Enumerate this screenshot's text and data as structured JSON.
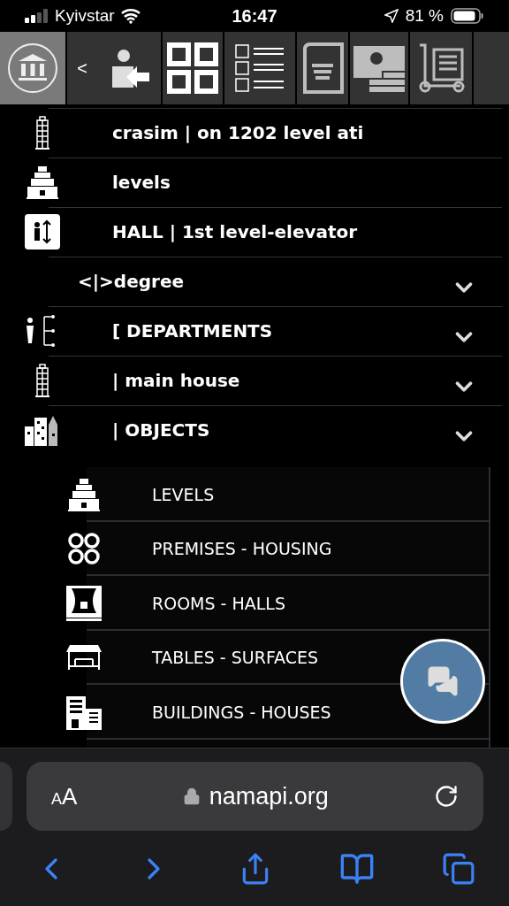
{
  "status_bar": {
    "carrier": "Kyivstar",
    "time": "16:47",
    "battery": "81 %"
  },
  "toolbar": {
    "back_label": "<",
    "tabs": [
      {
        "selected": true
      },
      {
        "selected": false
      },
      {
        "selected": false
      },
      {
        "selected": false
      },
      {
        "selected": false
      },
      {
        "selected": false
      },
      {
        "selected": false
      },
      {
        "selected": false
      }
    ]
  },
  "menu": [
    {
      "label": "crasim | on 1202 level ati",
      "has_submenu": false
    },
    {
      "label": "levels",
      "has_submenu": false
    },
    {
      "label": "HALL | 1st level-elevator",
      "has_submenu": false
    },
    {
      "label": "<|>degree",
      "has_submenu": true
    },
    {
      "label": "[ DEPARTMENTS",
      "has_submenu": true
    },
    {
      "label": "| main house",
      "has_submenu": true
    },
    {
      "label": "| OBJECTS",
      "has_submenu": true
    }
  ],
  "submenu": [
    "LEVELS",
    "PREMISES - HOUSING",
    "ROOMS - HALLS",
    "TABLES - SURFACES",
    "BUILDINGS - HOUSES"
  ],
  "browser": {
    "text_size_button": "AA",
    "url": "namapi.org"
  }
}
